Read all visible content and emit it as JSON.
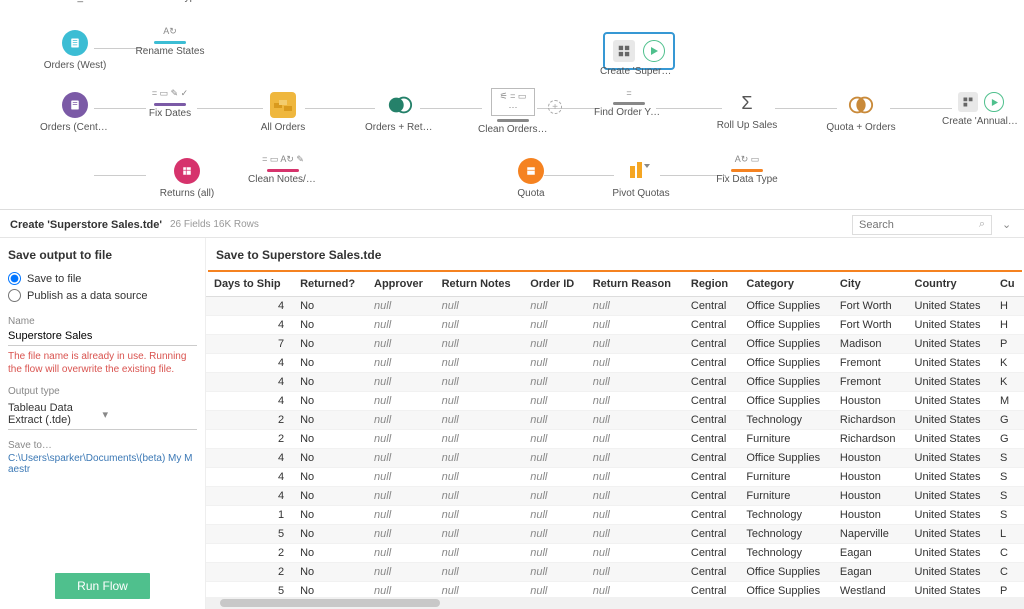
{
  "flow": {
    "nodes": {
      "orders_east": "Orders_East",
      "orders_west": "Orders (West)",
      "orders_central": "Orders (Central)",
      "returns_all": "Returns (all)",
      "fix_data_type_top": "Fix Data Type",
      "rename_states": "Rename States",
      "fix_dates": "Fix Dates",
      "clean_notes": "Clean Notes/Ap…",
      "all_orders": "All Orders",
      "orders_returns": "Orders + Returns",
      "clean_orders": "Clean Orders + …",
      "find_order_year": "Find Order Year",
      "roll_up_sales": "Roll Up Sales",
      "quota_orders": "Quota + Orders",
      "create_annual": "Create 'Annual …",
      "quota": "Quota",
      "pivot_quotas": "Pivot Quotas",
      "fix_data_type_bottom": "Fix Data Type",
      "create_superstore": "Create 'Superst…"
    }
  },
  "infobar": {
    "title": "Create 'Superstore Sales.tde'",
    "meta": "26 Fields   16K Rows",
    "search_placeholder": "Search"
  },
  "side": {
    "heading": "Save output to file",
    "radio_save": "Save to file",
    "radio_publish": "Publish as a data source",
    "name_label": "Name",
    "name_value": "Superstore Sales",
    "warning": "The file name is already in use. Running the flow will overwrite the existing file.",
    "output_type_label": "Output type",
    "output_type_value": "Tableau Data Extract (.tde)",
    "save_to_label": "Save to…",
    "save_to_path": "C:\\Users\\sparker\\Documents\\(beta) My Maestr",
    "run_button": "Run Flow"
  },
  "data": {
    "title": "Save to Superstore Sales.tde",
    "columns": [
      "Days to Ship",
      "Returned?",
      "Approver",
      "Return Notes",
      "Order ID",
      "Return Reason",
      "Region",
      "Category",
      "City",
      "Country",
      "Cu"
    ],
    "rows": [
      {
        "days": 4,
        "returned": "No",
        "region": "Central",
        "category": "Office Supplies",
        "city": "Fort Worth",
        "country": "United States",
        "cu": "H"
      },
      {
        "days": 4,
        "returned": "No",
        "region": "Central",
        "category": "Office Supplies",
        "city": "Fort Worth",
        "country": "United States",
        "cu": "H"
      },
      {
        "days": 7,
        "returned": "No",
        "region": "Central",
        "category": "Office Supplies",
        "city": "Madison",
        "country": "United States",
        "cu": "P"
      },
      {
        "days": 4,
        "returned": "No",
        "region": "Central",
        "category": "Office Supplies",
        "city": "Fremont",
        "country": "United States",
        "cu": "K"
      },
      {
        "days": 4,
        "returned": "No",
        "region": "Central",
        "category": "Office Supplies",
        "city": "Fremont",
        "country": "United States",
        "cu": "K"
      },
      {
        "days": 4,
        "returned": "No",
        "region": "Central",
        "category": "Office Supplies",
        "city": "Houston",
        "country": "United States",
        "cu": "M"
      },
      {
        "days": 2,
        "returned": "No",
        "region": "Central",
        "category": "Technology",
        "city": "Richardson",
        "country": "United States",
        "cu": "G"
      },
      {
        "days": 2,
        "returned": "No",
        "region": "Central",
        "category": "Furniture",
        "city": "Richardson",
        "country": "United States",
        "cu": "G"
      },
      {
        "days": 4,
        "returned": "No",
        "region": "Central",
        "category": "Office Supplies",
        "city": "Houston",
        "country": "United States",
        "cu": "S"
      },
      {
        "days": 4,
        "returned": "No",
        "region": "Central",
        "category": "Furniture",
        "city": "Houston",
        "country": "United States",
        "cu": "S"
      },
      {
        "days": 4,
        "returned": "No",
        "region": "Central",
        "category": "Furniture",
        "city": "Houston",
        "country": "United States",
        "cu": "S"
      },
      {
        "days": 1,
        "returned": "No",
        "region": "Central",
        "category": "Technology",
        "city": "Houston",
        "country": "United States",
        "cu": "S"
      },
      {
        "days": 5,
        "returned": "No",
        "region": "Central",
        "category": "Technology",
        "city": "Naperville",
        "country": "United States",
        "cu": "L"
      },
      {
        "days": 2,
        "returned": "No",
        "region": "Central",
        "category": "Technology",
        "city": "Eagan",
        "country": "United States",
        "cu": "C"
      },
      {
        "days": 2,
        "returned": "No",
        "region": "Central",
        "category": "Office Supplies",
        "city": "Eagan",
        "country": "United States",
        "cu": "C"
      },
      {
        "days": 5,
        "returned": "No",
        "region": "Central",
        "category": "Office Supplies",
        "city": "Westland",
        "country": "United States",
        "cu": "P"
      }
    ]
  },
  "null_text": "null"
}
